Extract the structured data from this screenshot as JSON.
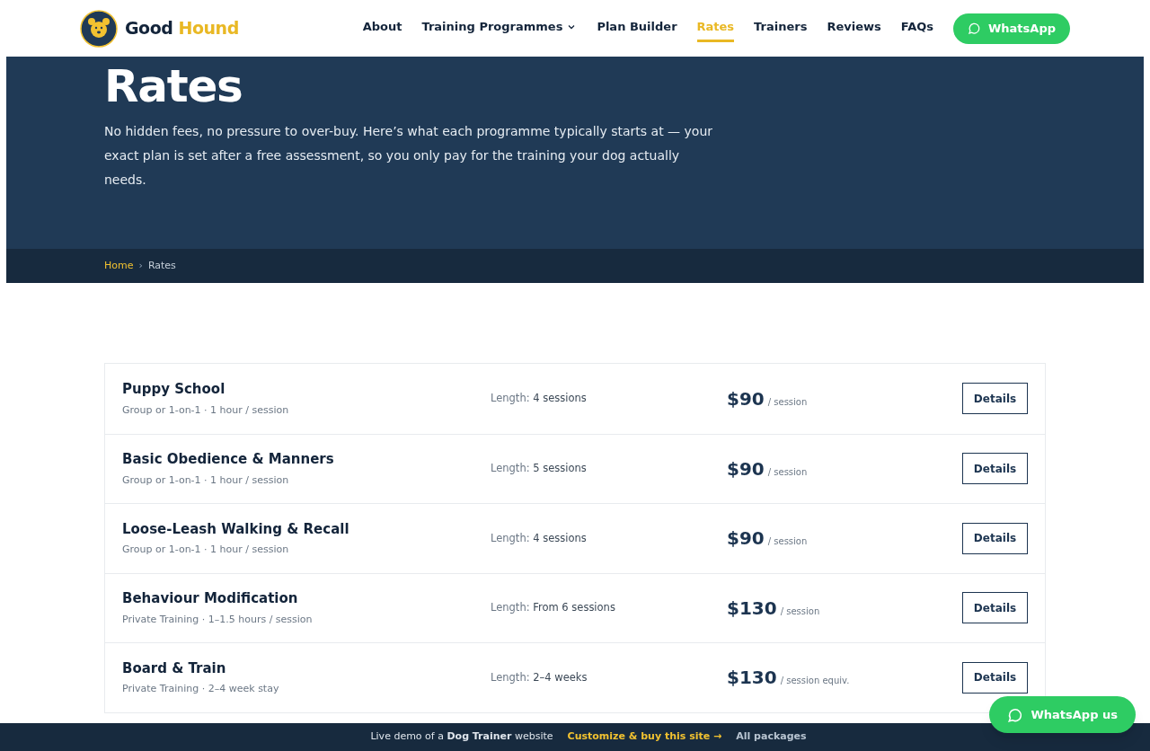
{
  "header": {
    "logo_first": "Good",
    "logo_second": "Hound",
    "nav": [
      {
        "label": "About",
        "selected": false,
        "dropdown": false
      },
      {
        "label": "Training Programmes",
        "selected": false,
        "dropdown": true
      },
      {
        "label": "Plan Builder",
        "selected": false,
        "dropdown": false
      },
      {
        "label": "Rates",
        "selected": true,
        "dropdown": false
      },
      {
        "label": "Trainers",
        "selected": false,
        "dropdown": false
      },
      {
        "label": "Reviews",
        "selected": false,
        "dropdown": false
      },
      {
        "label": "FAQs",
        "selected": false,
        "dropdown": false
      }
    ],
    "cta": "WhatsApp"
  },
  "hero": {
    "title": "Rates",
    "text": "No hidden fees, no pressure to over-buy. Here’s what each programme typically starts at — your exact plan is set after a free assessment, so you only pay for the training your dog actually needs."
  },
  "breadcrumb_separator": "›",
  "breadcrumb": [
    {
      "label": "Home",
      "selected": false
    },
    {
      "label": "Rates",
      "selected": true
    }
  ],
  "rates": [
    {
      "name": "Puppy School",
      "meta": "Group or 1-on-1 · 1 hour / session",
      "length_label": "Length:",
      "length": "4 sessions",
      "price": "$90",
      "unit": "/ session",
      "button": "Details"
    },
    {
      "name": "Basic Obedience & Manners",
      "meta": "Group or 1-on-1 · 1 hour / session",
      "length_label": "Length:",
      "length": "5 sessions",
      "price": "$90",
      "unit": "/ session",
      "button": "Details"
    },
    {
      "name": "Loose-Leash Walking & Recall",
      "meta": "Group or 1-on-1 · 1 hour / session",
      "length_label": "Length:",
      "length": "4 sessions",
      "price": "$90",
      "unit": "/ session",
      "button": "Details"
    },
    {
      "name": "Behaviour Modification",
      "meta": "Private Training · 1–1.5 hours / session",
      "length_label": "Length:",
      "length": "From 6 sessions",
      "price": "$130",
      "unit": "/ session",
      "button": "Details"
    },
    {
      "name": "Board & Train",
      "meta": "Private Training · 2–4 week stay",
      "length_label": "Length:",
      "length": "2–4 weeks",
      "price": "$130",
      "unit": "/ session equiv.",
      "button": "Details"
    }
  ],
  "floating_button": "WhatsApp us",
  "demo_bar": {
    "text": "Live demo of a **Dog Trainer** website",
    "link": "Customize & buy this site →",
    "packages": "All packages"
  }
}
